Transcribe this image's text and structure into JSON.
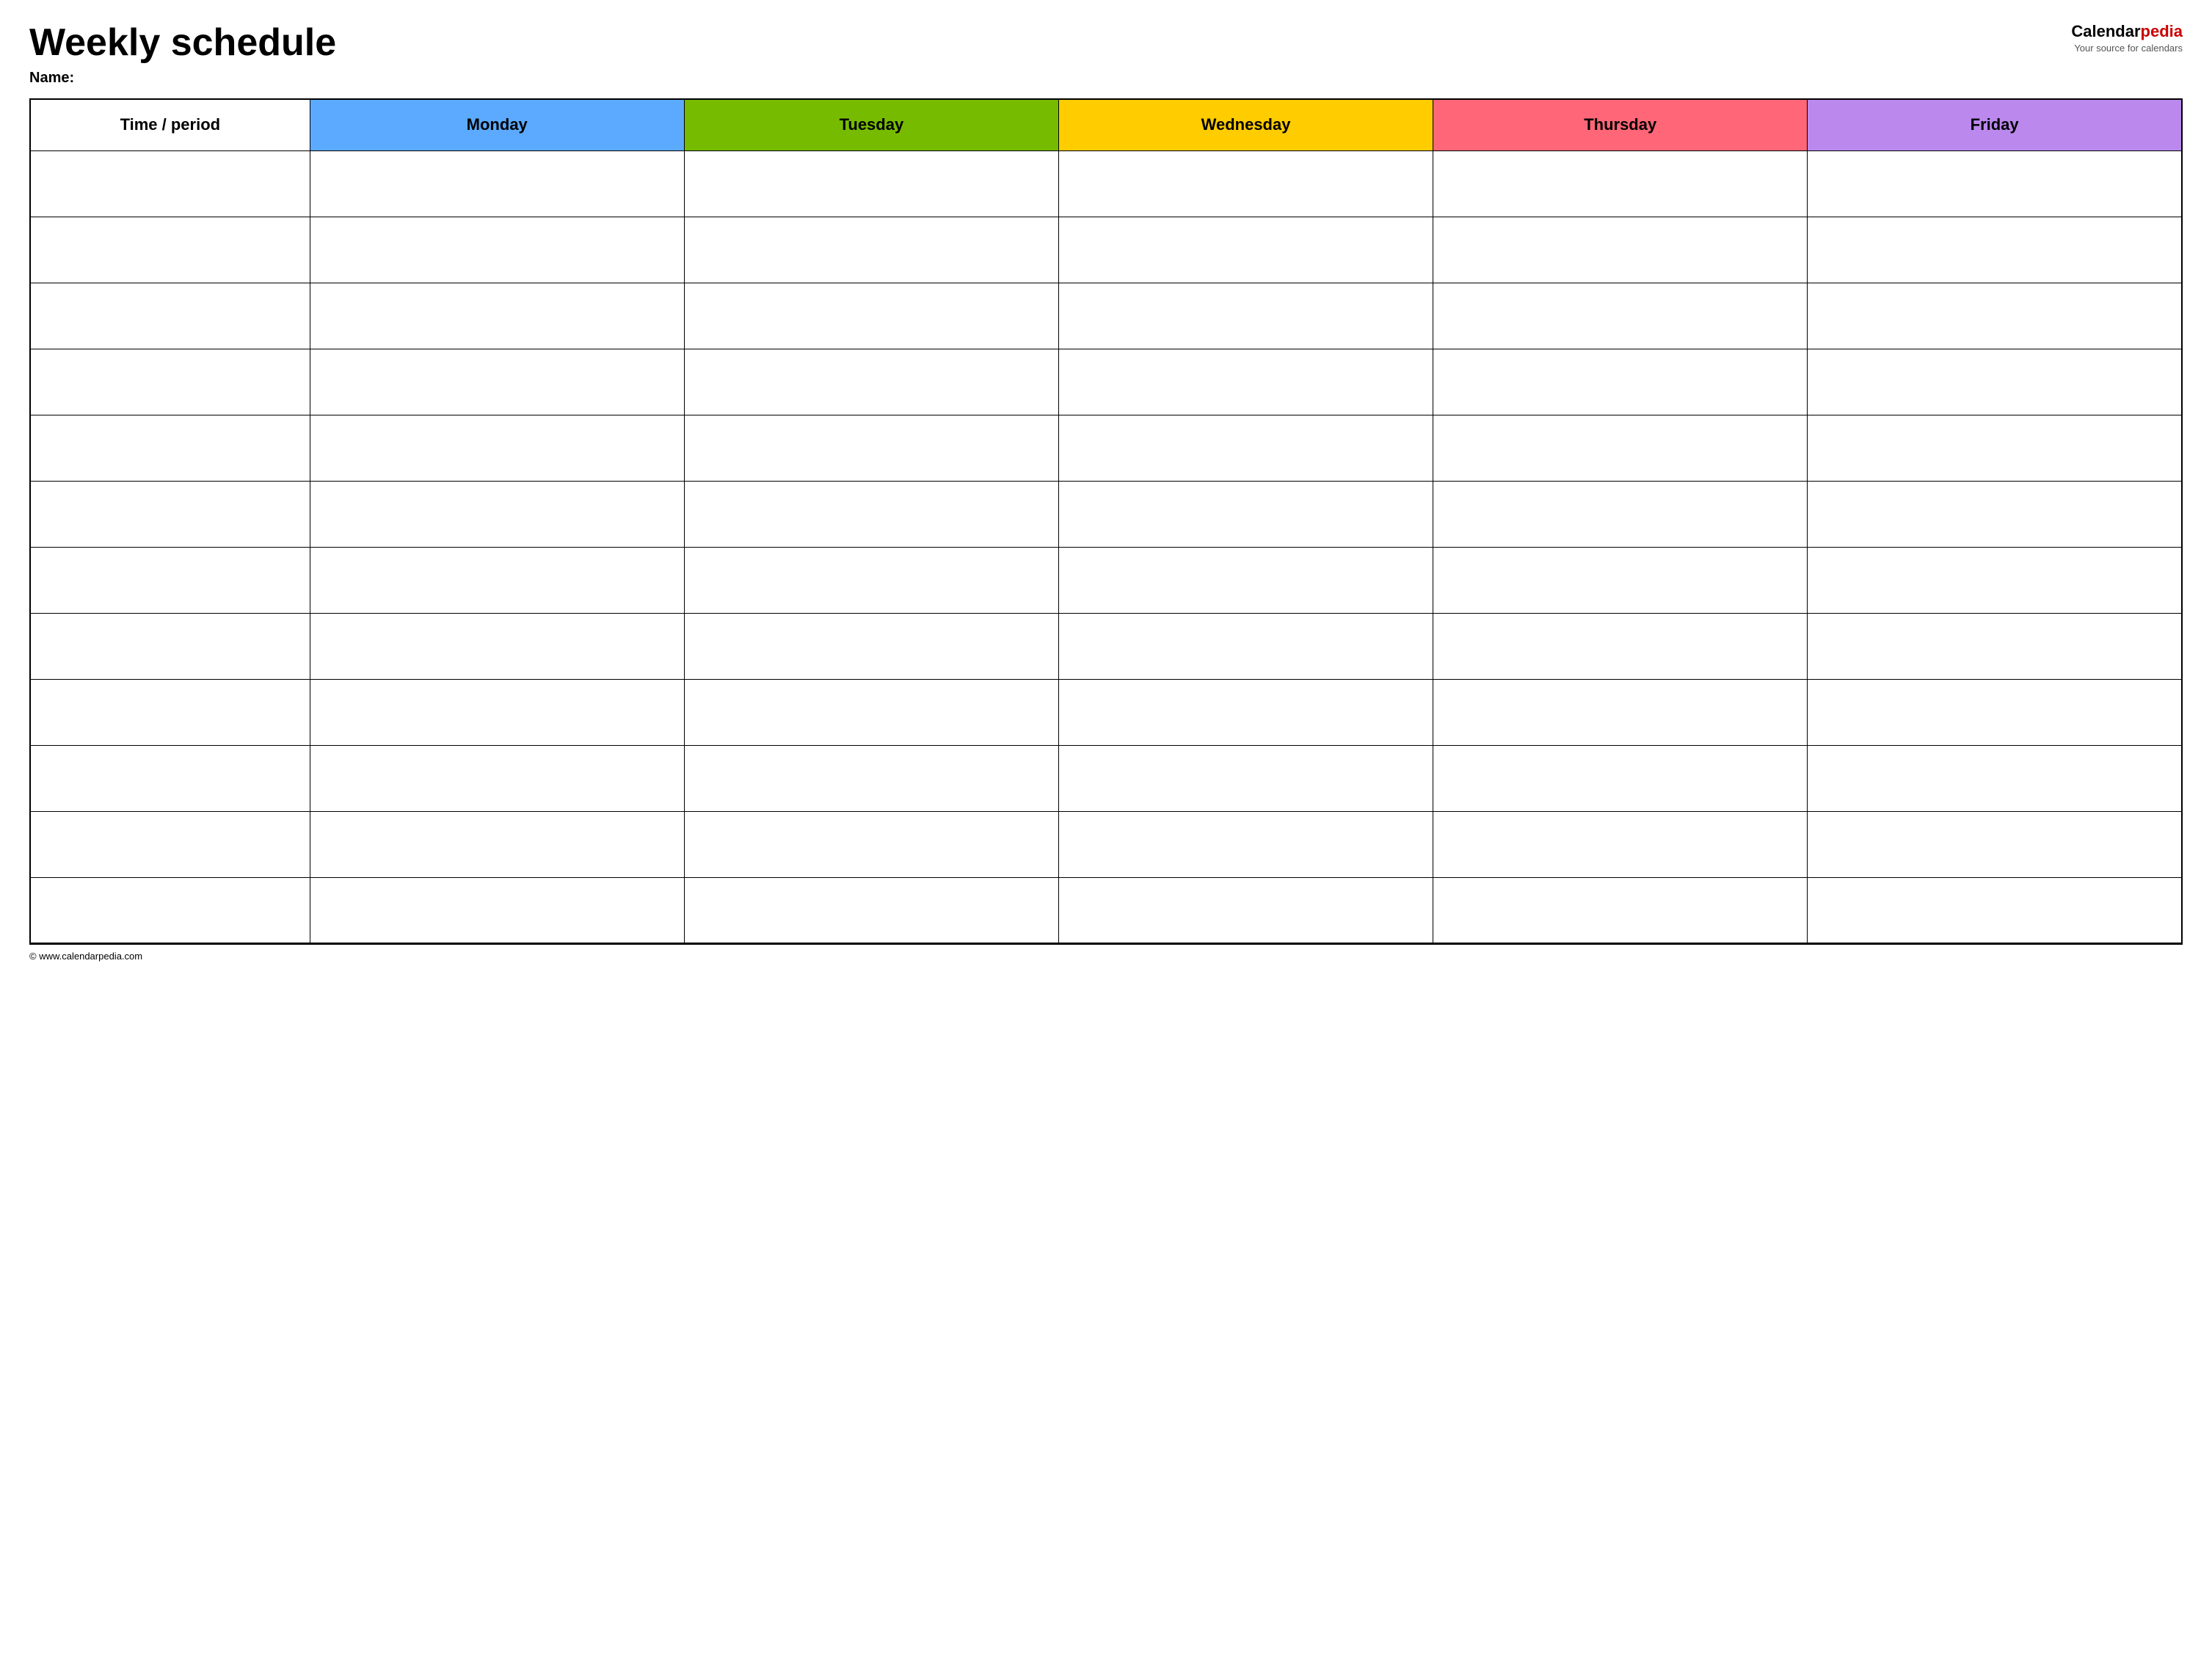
{
  "header": {
    "title": "Weekly schedule",
    "name_label": "Name:",
    "logo": {
      "calendar": "Calendar",
      "pedia": "pedia",
      "tagline": "Your source for calendars"
    }
  },
  "table": {
    "columns": [
      {
        "id": "time",
        "label": "Time / period",
        "color": "#ffffff"
      },
      {
        "id": "monday",
        "label": "Monday",
        "color": "#5baaff"
      },
      {
        "id": "tuesday",
        "label": "Tuesday",
        "color": "#77bb00"
      },
      {
        "id": "wednesday",
        "label": "Wednesday",
        "color": "#ffcc00"
      },
      {
        "id": "thursday",
        "label": "Thursday",
        "color": "#ff6677"
      },
      {
        "id": "friday",
        "label": "Friday",
        "color": "#bb88ee"
      }
    ],
    "rows": 12
  },
  "footer": {
    "copyright": "© www.calendarpedia.com"
  }
}
